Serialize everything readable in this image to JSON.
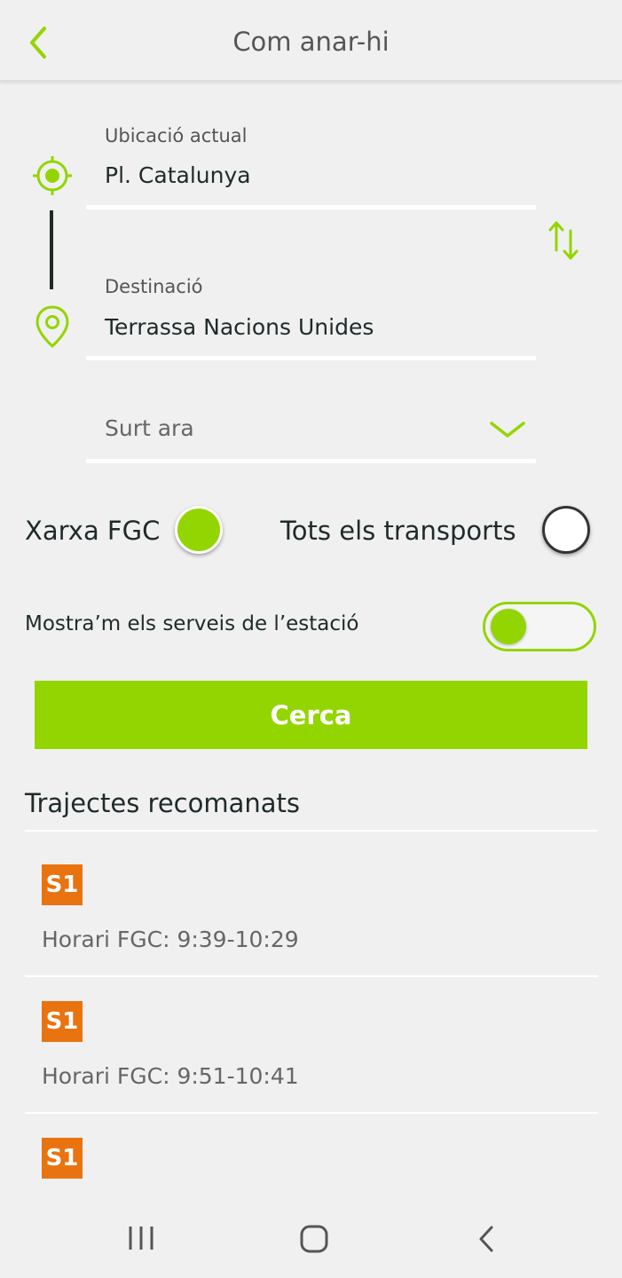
{
  "header": {
    "title": "Com anar-hi",
    "back_icon": "chevron-left-icon"
  },
  "origin": {
    "label": "Ubicació actual",
    "value": "Pl. Catalunya",
    "icon": "location-target-icon"
  },
  "destination": {
    "label": "Destinació",
    "value": "Terrassa Nacions Unides",
    "icon": "map-pin-icon"
  },
  "swap_icon": "swap-vertical-icon",
  "time_select": {
    "value": "Surt ara",
    "icon": "chevron-down-icon"
  },
  "network_options": {
    "fgc_label": "Xarxa FGC",
    "fgc_selected": true,
    "all_label": "Tots els transports",
    "all_selected": false
  },
  "station_services": {
    "label": "Mostra’m els serveis de l’estació",
    "enabled": false
  },
  "search_button": "Cerca",
  "recommended": {
    "title": "Trajectes recomanats",
    "routes": [
      {
        "line": "S1",
        "schedule": "Horari FGC: 9:39-10:29"
      },
      {
        "line": "S1",
        "schedule": "Horari FGC: 9:51-10:41"
      },
      {
        "line": "S1",
        "schedule": ""
      }
    ]
  },
  "colors": {
    "accent": "#93d500",
    "line_s1": "#e8730f",
    "background": "#f0f0f0"
  },
  "navbar": {
    "recents_icon": "recents-icon",
    "home_icon": "home-icon",
    "back_icon": "back-icon"
  }
}
